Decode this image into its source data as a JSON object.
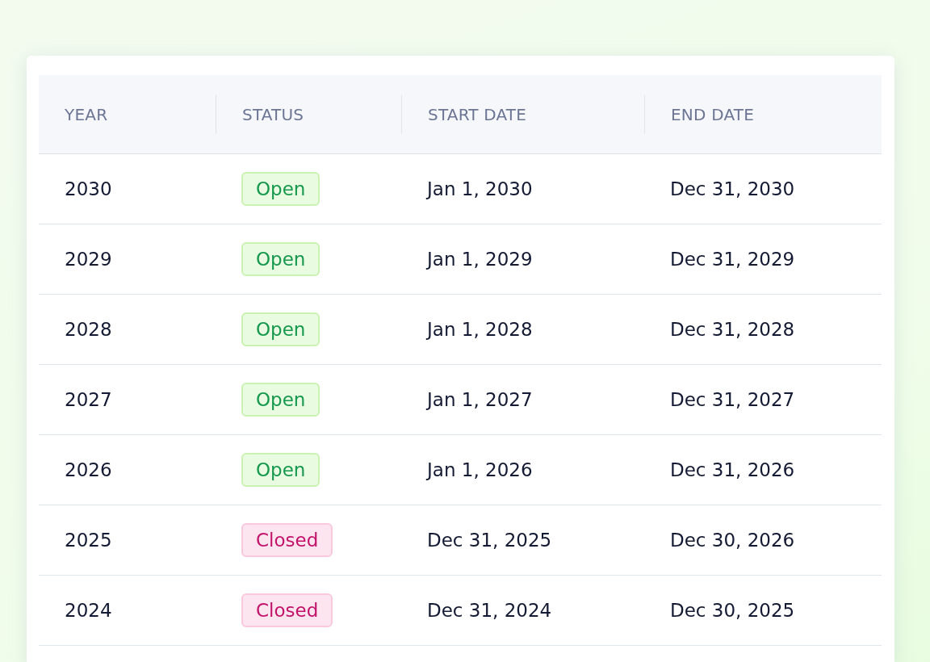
{
  "table": {
    "columns": [
      "YEAR",
      "STATUS",
      "START DATE",
      "END DATE"
    ],
    "rows": [
      {
        "year": "2030",
        "status": {
          "label": "Open",
          "kind": "open"
        },
        "start": "Jan 1, 2030",
        "end": "Dec 31, 2030"
      },
      {
        "year": "2029",
        "status": {
          "label": "Open",
          "kind": "open"
        },
        "start": "Jan 1, 2029",
        "end": "Dec 31, 2029"
      },
      {
        "year": "2028",
        "status": {
          "label": "Open",
          "kind": "open"
        },
        "start": "Jan 1, 2028",
        "end": "Dec 31, 2028"
      },
      {
        "year": "2027",
        "status": {
          "label": "Open",
          "kind": "open"
        },
        "start": "Jan 1, 2027",
        "end": "Dec 31, 2027"
      },
      {
        "year": "2026",
        "status": {
          "label": "Open",
          "kind": "open"
        },
        "start": "Jan 1, 2026",
        "end": "Dec 31, 2026"
      },
      {
        "year": "2025",
        "status": {
          "label": "Closed",
          "kind": "closed"
        },
        "start": "Dec 31, 2025",
        "end": "Dec 30, 2026"
      },
      {
        "year": "2024",
        "status": {
          "label": "Closed",
          "kind": "closed"
        },
        "start": "Dec 31, 2024",
        "end": "Dec 30, 2025"
      }
    ]
  }
}
